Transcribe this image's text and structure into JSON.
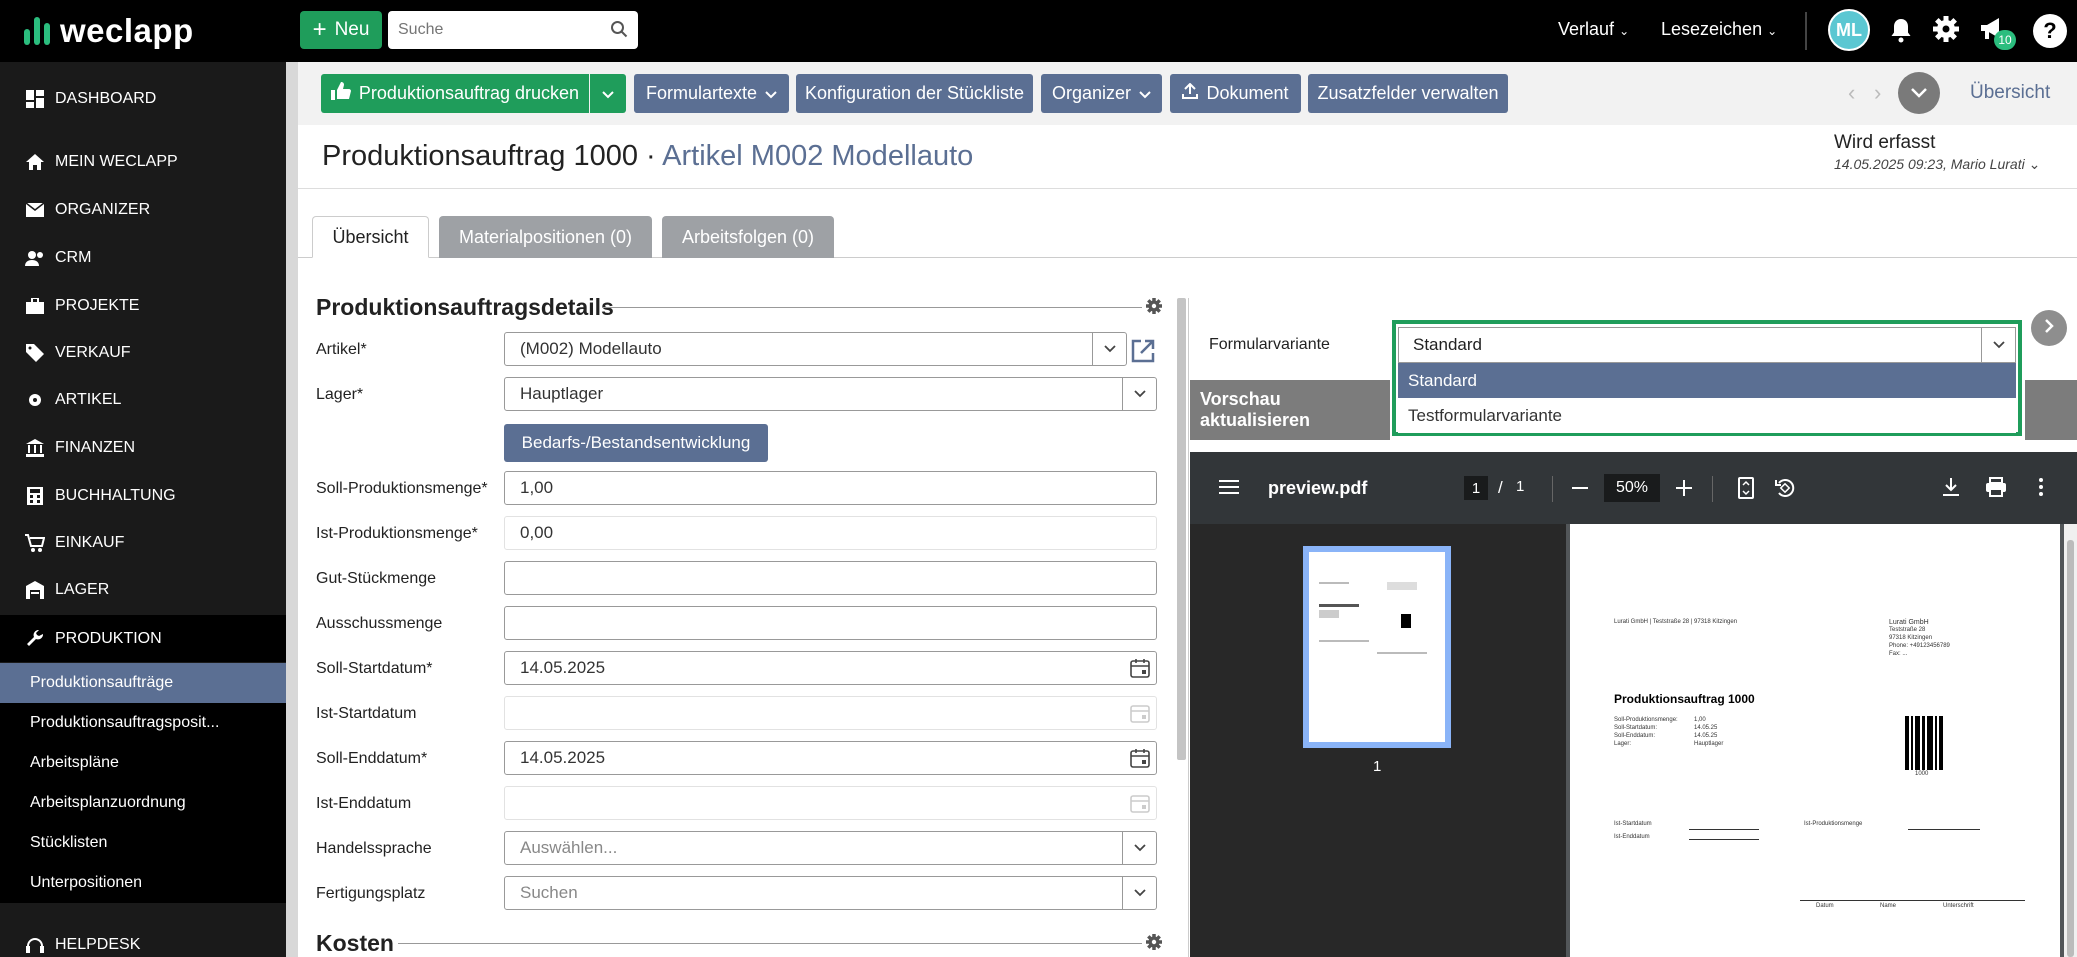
{
  "app": {
    "brand": "weclapp"
  },
  "topbar": {
    "new_label": "Neu",
    "search_placeholder": "Suche",
    "history_label": "Verlauf",
    "bookmarks_label": "Lesezeichen",
    "avatar_initials": "ML",
    "notification_count": "10",
    "help_label": "?"
  },
  "sidebar": {
    "items": [
      {
        "label": "DASHBOARD",
        "icon": "dashboard-icon"
      },
      {
        "label": "MEIN WECLAPP",
        "icon": "home-icon"
      },
      {
        "label": "ORGANIZER",
        "icon": "mail-icon"
      },
      {
        "label": "CRM",
        "icon": "contacts-icon"
      },
      {
        "label": "PROJEKTE",
        "icon": "briefcase-icon"
      },
      {
        "label": "VERKAUF",
        "icon": "tag-icon"
      },
      {
        "label": "ARTIKEL",
        "icon": "article-icon"
      },
      {
        "label": "FINANZEN",
        "icon": "bank-icon"
      },
      {
        "label": "BUCHHALTUNG",
        "icon": "calculator-icon"
      },
      {
        "label": "EINKAUF",
        "icon": "cart-icon"
      },
      {
        "label": "LAGER",
        "icon": "warehouse-icon"
      },
      {
        "label": "PRODUKTION",
        "icon": "wrench-icon"
      }
    ],
    "sub_items": [
      {
        "label": "Produktionsaufträge",
        "active": true
      },
      {
        "label": "Produktionsauftragsposit..."
      },
      {
        "label": "Arbeitspläne"
      },
      {
        "label": "Arbeitsplanzuordnung"
      },
      {
        "label": "Stücklisten"
      },
      {
        "label": "Unterpositionen"
      }
    ],
    "helpdesk_label": "HELPDESK"
  },
  "toolbar": {
    "print_label": "Produktionsauftrag drucken",
    "formtexts_label": "Formulartexte",
    "bom_config_label": "Konfiguration der Stückliste",
    "organizer_label": "Organizer",
    "document_label": "Dokument",
    "extra_fields_label": "Zusatzfelder verwalten",
    "overview_link": "Übersicht"
  },
  "header": {
    "title_main": "Produktionsauftrag 1000 · ",
    "title_article": "Artikel M002 Modellauto",
    "status": "Wird erfasst",
    "status_sub": "14.05.2025 09:23, Mario Lurati"
  },
  "tabs": [
    {
      "label": "Übersicht",
      "active": true
    },
    {
      "label": "Materialpositionen (0)"
    },
    {
      "label": "Arbeitsfolgen (0)"
    }
  ],
  "details": {
    "section_title": "Produktionsauftragsdetails",
    "artikel_label": "Artikel*",
    "artikel_value": "(M002) Modellauto",
    "lager_label": "Lager*",
    "lager_value": "Hauptlager",
    "bedarf_button": "Bedarfs-/Bestandsentwicklung",
    "soll_menge_label": "Soll-Produktionsmenge*",
    "soll_menge_value": "1,00",
    "ist_menge_label": "Ist-Produktionsmenge*",
    "ist_menge_value": "0,00",
    "gut_label": "Gut-Stückmenge",
    "gut_value": "",
    "ausschuss_label": "Ausschussmenge",
    "ausschuss_value": "",
    "soll_start_label": "Soll-Startdatum*",
    "soll_start_value": "14.05.2025",
    "ist_start_label": "Ist-Startdatum",
    "ist_start_value": "",
    "soll_end_label": "Soll-Enddatum*",
    "soll_end_value": "14.05.2025",
    "ist_end_label": "Ist-Enddatum",
    "ist_end_value": "",
    "sprache_label": "Handelssprache",
    "sprache_placeholder": "Auswählen...",
    "platz_label": "Fertigungsplatz",
    "platz_placeholder": "Suchen",
    "kosten_title": "Kosten"
  },
  "preview": {
    "variant_label": "Formularvariante",
    "variant_value": "Standard",
    "options": [
      "Standard",
      "Testformularvariante"
    ],
    "refresh_label": "Vorschau aktualisieren",
    "pdf_name": "preview.pdf",
    "page_current": "1",
    "page_sep": "/",
    "page_total": "1",
    "zoom": "50%",
    "thumb_number": "1"
  },
  "pdf_page": {
    "sender_line": "Lurati GmbH | Teststraße 28 | 97318 Kitzingen",
    "company": "Lurati GmbH",
    "street": "Teststraße 28",
    "city": "97318 Kitzingen",
    "phone": "Phone: +49123456789",
    "fax": "Fax: ...",
    "title": "Produktionsauftrag 1000",
    "rows": [
      {
        "k": "Soll-Produktionsmenge:",
        "v": "1,00"
      },
      {
        "k": "Soll-Startdatum:",
        "v": "14.05.25"
      },
      {
        "k": "Soll-Enddatum:",
        "v": "14.05.25"
      },
      {
        "k": "Lager:",
        "v": "Hauptlager"
      }
    ],
    "barcode_number": "1000",
    "ist_start": "Ist-Startdatum",
    "ist_end": "Ist-Enddatum",
    "ist_menge": "Ist-Produktionsmenge",
    "sig_date": "Datum",
    "sig_name": "Name",
    "sig_sign": "Unterschrift"
  },
  "colors": {
    "accent_green": "#1f9d5b",
    "primary_blue": "#5b6f93",
    "sidebar_bg": "#1a1a1a"
  }
}
